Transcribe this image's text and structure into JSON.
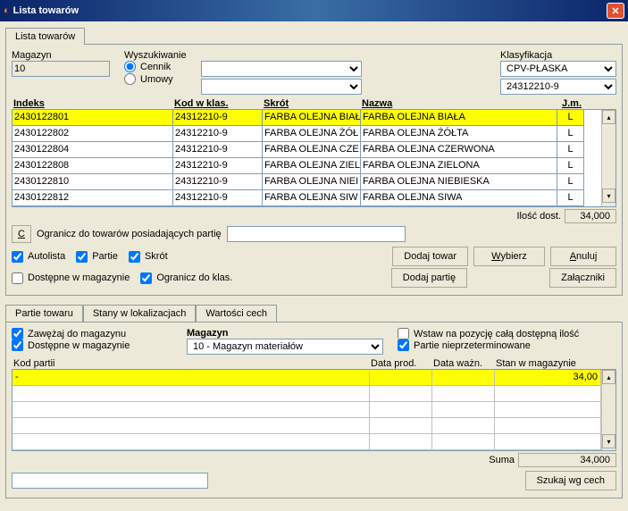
{
  "title": "Lista towarów",
  "tab_main": "Lista towarów",
  "labels": {
    "magazyn": "Magazyn",
    "wyszukiwanie": "Wyszukiwanie",
    "klasyfikacja": "Klasyfikacja",
    "cennik": "Cennik",
    "umowy": "Umowy",
    "ilosc_dost": "Ilość dost.",
    "ogranicz_partia": "Ogranicz do towarów posiadających partię",
    "autolista": "Autolista",
    "partie": "Partie",
    "skrot": "Skrót",
    "dostepne_mag": "Dostępne w magazynie",
    "ogranicz_klas": "Ogranicz do klas.",
    "dodaj_towar": "Dodaj towar",
    "wybierz": "Wybierz",
    "anuluj": "Anuluj",
    "dodaj_partie": "Dodaj partię",
    "zalaczniki": "Załączniki",
    "zawezaj": "Zawężaj do magazynu",
    "dostepne_mag2": "Dostępne w magazynie",
    "magazyn2": "Magazyn",
    "wstaw": "Wstaw na pozycję całą dostępną ilość",
    "partie_nieprzeterm": "Partie nieprzeterminowane",
    "suma": "Suma",
    "szukaj": "Szukaj wg cech",
    "c": "C"
  },
  "magazyn_value": "10",
  "klasyfikacja_value": "CPV-PŁASKA",
  "klasyfikacja_sub": "24312210-9",
  "headers": {
    "indeks": "Indeks",
    "kod": "Kod w klas.",
    "skrot": "Skrót",
    "nazwa": "Nazwa",
    "jm": "J.m."
  },
  "rows": [
    {
      "idx": "2430122801",
      "kod": "24312210-9",
      "skrot": "FARBA OLEJNA BIAŁ",
      "nazwa": "FARBA OLEJNA BIAŁA",
      "jm": "L",
      "sel": true
    },
    {
      "idx": "2430122802",
      "kod": "24312210-9",
      "skrot": "FARBA OLEJNA ŻÓŁ",
      "nazwa": "FARBA OLEJNA ŻÓŁTA",
      "jm": "L",
      "sel": false
    },
    {
      "idx": "2430122804",
      "kod": "24312210-9",
      "skrot": "FARBA OLEJNA CZE",
      "nazwa": "FARBA OLEJNA CZERWONA",
      "jm": "L",
      "sel": false
    },
    {
      "idx": "2430122808",
      "kod": "24312210-9",
      "skrot": "FARBA OLEJNA ZIEL",
      "nazwa": "FARBA OLEJNA ZIELONA",
      "jm": "L",
      "sel": false
    },
    {
      "idx": "2430122810",
      "kod": "24312210-9",
      "skrot": "FARBA OLEJNA NIEI",
      "nazwa": "FARBA OLEJNA NIEBIESKA",
      "jm": "L",
      "sel": false
    },
    {
      "idx": "2430122812",
      "kod": "24312210-9",
      "skrot": "FARBA OLEJNA SIW",
      "nazwa": "FARBA OLEJNA SIWA",
      "jm": "L",
      "sel": false
    }
  ],
  "ilosc_dost_val": "34,000",
  "sub_tabs": [
    "Partie towaru",
    "Stany w lokalizacjach",
    "Wartości cech"
  ],
  "magazyn2_value": "10 - Magazyn materiałów",
  "headers2": {
    "kod": "Kod partii",
    "prod": "Data prod.",
    "wazn": "Data ważn.",
    "stan": "Stan w magazynie"
  },
  "rows2": [
    {
      "kod": "-",
      "prod": "",
      "wazn": "",
      "stan": "34,00",
      "sel": true
    },
    {
      "kod": "",
      "prod": "",
      "wazn": "",
      "stan": ""
    },
    {
      "kod": "",
      "prod": "",
      "wazn": "",
      "stan": ""
    },
    {
      "kod": "",
      "prod": "",
      "wazn": "",
      "stan": ""
    },
    {
      "kod": "",
      "prod": "",
      "wazn": "",
      "stan": ""
    }
  ],
  "suma_val": "34,000",
  "checks": {
    "autolista": true,
    "partie": true,
    "skrot": true,
    "dostepne_mag": false,
    "ogranicz_klas": true,
    "zawezaj": true,
    "dostepne_mag2": true,
    "wstaw": false,
    "partie_nieprzeterm": true
  }
}
